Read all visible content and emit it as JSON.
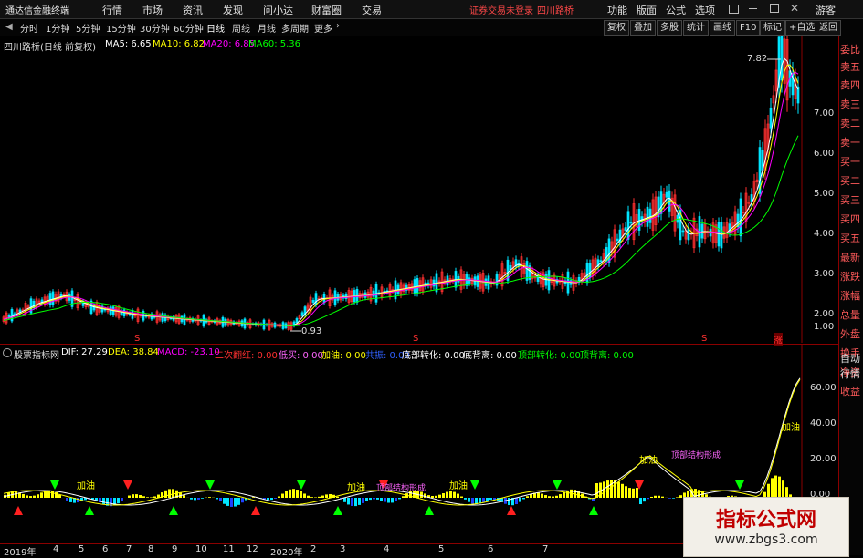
{
  "menubar": {
    "brand": "通达信金融终端",
    "items": [
      "行情",
      "市场",
      "资讯",
      "发现",
      "问小达",
      "财富圈",
      "交易"
    ],
    "notice": "证券交易未登录",
    "stock": "四川路桥",
    "right": [
      "功能",
      "版面",
      "公式",
      "选项"
    ],
    "guest": "游客"
  },
  "periodbar": {
    "periods": [
      "分时",
      "1分钟",
      "5分钟",
      "15分钟",
      "30分钟",
      "60分钟",
      "日线",
      "周线",
      "月线",
      "多周期",
      "更多"
    ],
    "active": "日线",
    "tools": [
      "复权",
      "叠加",
      "多股",
      "统计",
      "画线",
      "F10",
      "标记",
      "+自选",
      "返回"
    ]
  },
  "main": {
    "title": "四川路桥(日线 前复权)",
    "ma": [
      {
        "label": "MA5: 6.65",
        "color": "#ffffff"
      },
      {
        "label": "MA10: 6.82",
        "color": "#ffff00"
      },
      {
        "label": "MA20: 6.85",
        "color": "#ff00ff"
      },
      {
        "label": "MA60: 5.36",
        "color": "#00ff00"
      }
    ],
    "price_axis": [
      "7.00",
      "6.00",
      "5.00",
      "4.00",
      "3.00",
      "2.00",
      "1.00"
    ],
    "high_label": "7.82",
    "low_label": "0.93",
    "markers": [
      "S",
      "S",
      "S",
      "涨"
    ]
  },
  "indicator": {
    "name": "股票指标网",
    "items": [
      {
        "label": "DIF: 27.29",
        "color": "#ffffff"
      },
      {
        "label": "DEA: 38.84",
        "color": "#ffff00"
      },
      {
        "label": "MACD: -23.10",
        "color": "#ff00ff"
      },
      {
        "label": "二次翻红: 0.00",
        "color": "#ff3030"
      },
      {
        "label": "低买: 0.00",
        "color": "#ff66ff"
      },
      {
        "label": "加油: 0.00",
        "color": "#ffff00"
      },
      {
        "label": "共振: 0.00",
        "color": "#3060ff"
      },
      {
        "label": "底部转化: 0.00",
        "color": "#ffffff"
      },
      {
        "label": "底背离: 0.00",
        "color": "#ffffff"
      },
      {
        "label": "顶部转化: 0.00",
        "color": "#00ff00"
      },
      {
        "label": "顶背离: 0.00",
        "color": "#00ff00"
      }
    ],
    "axis": [
      "60.00",
      "40.00",
      "20.00",
      "0.00"
    ],
    "chart_labels": [
      "加油",
      "加油",
      "加油",
      "顶部结构形成",
      "顶部结构形成",
      "加油",
      "加油"
    ]
  },
  "timeaxis": [
    "2019年",
    "4",
    "5",
    "6",
    "7",
    "8",
    "9",
    "10",
    "11",
    "12",
    "2020年",
    "2",
    "3",
    "4",
    "5",
    "6",
    "7"
  ],
  "sidebar": [
    "委比",
    "卖五",
    "卖四",
    "卖三",
    "卖二",
    "卖一",
    "买一",
    "买二",
    "买三",
    "买四",
    "买五",
    "最新",
    "涨跌",
    "涨幅",
    "总量",
    "外盘",
    "换手",
    "净资",
    "收益",
    "自动",
    "行情"
  ],
  "watermark": {
    "title": "指标公式网",
    "url": "www.zbgs3.com"
  }
}
